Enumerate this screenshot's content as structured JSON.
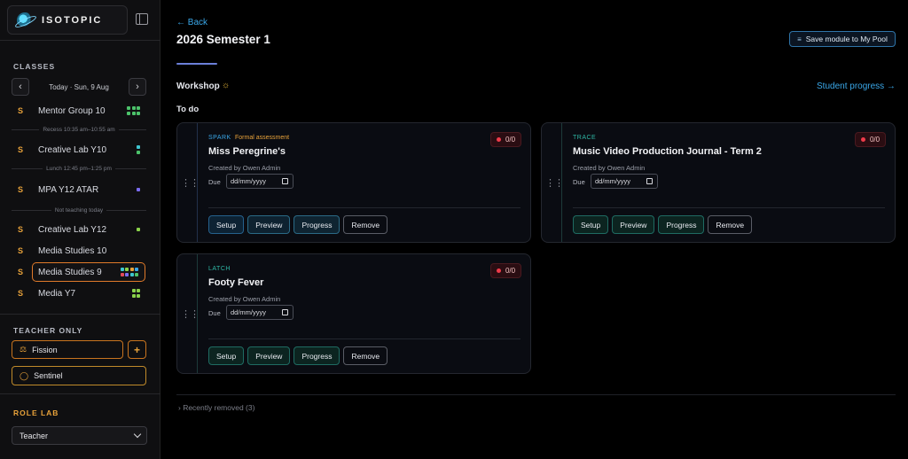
{
  "brand": {
    "name": "ISOTOPIC"
  },
  "sidebar": {
    "classes_label": "CLASSES",
    "date_label": "Today · Sun, 9 Aug",
    "classes": [
      {
        "s": "S",
        "name": "Mentor Group 10"
      },
      {
        "s": "S",
        "name": "Creative Lab Y10"
      },
      {
        "s": "S",
        "name": "MPA Y12 ATAR"
      },
      {
        "s": "S",
        "name": "Creative Lab Y12"
      },
      {
        "s": "S",
        "name": "Media Studies 10"
      },
      {
        "s": "S",
        "name": "Media Studies 9"
      },
      {
        "s": "S",
        "name": "Media Y7"
      }
    ],
    "separators": {
      "recess": "Recess  10:35 am–10:55 am",
      "lunch": "Lunch  12:45 pm–1:25 pm",
      "not_teaching": "Not teaching today"
    },
    "teacher_only_label": "TEACHER ONLY",
    "fission_label": "Fission",
    "plus_label": "+",
    "sentinel_label": "Sentinel",
    "role_lab_label": "ROLE LAB",
    "role_value": "Teacher"
  },
  "header": {
    "back": "← Back",
    "title": "2026 Semester 1",
    "save_module": "Save module to My Pool",
    "workshop": "Workshop",
    "student_progress": "Student progress →",
    "todo": "To do"
  },
  "cards": [
    {
      "kind": "SPARK",
      "tag": "Formal assessment",
      "title": "Miss Peregrine's",
      "creator": "Created by Owen Admin",
      "due_label": "Due",
      "due_placeholder": "dd/mm/yyyy",
      "score": "0/0"
    },
    {
      "kind": "TRACE",
      "tag": "",
      "title": "Music Video Production Journal - Term 2",
      "creator": "Created by Owen Admin",
      "due_label": "Due",
      "due_placeholder": "dd/mm/yyyy",
      "score": "0/0"
    },
    {
      "kind": "LATCH",
      "tag": "",
      "title": "Footy Fever",
      "creator": "Created by Owen Admin",
      "due_label": "Due",
      "due_placeholder": "dd/mm/yyyy",
      "score": "0/0"
    }
  ],
  "card_actions": {
    "setup": "Setup",
    "preview": "Preview",
    "progress": "Progress",
    "remove": "Remove"
  },
  "recently_removed": "›  Recently removed (3)",
  "colors": {
    "accent_blue": "#3aa7e8",
    "accent_orange": "#e8a23a",
    "score_red": "#ef3b4a",
    "trace_teal": "#2fb8a6",
    "spark_blue": "#3aa7e8"
  }
}
